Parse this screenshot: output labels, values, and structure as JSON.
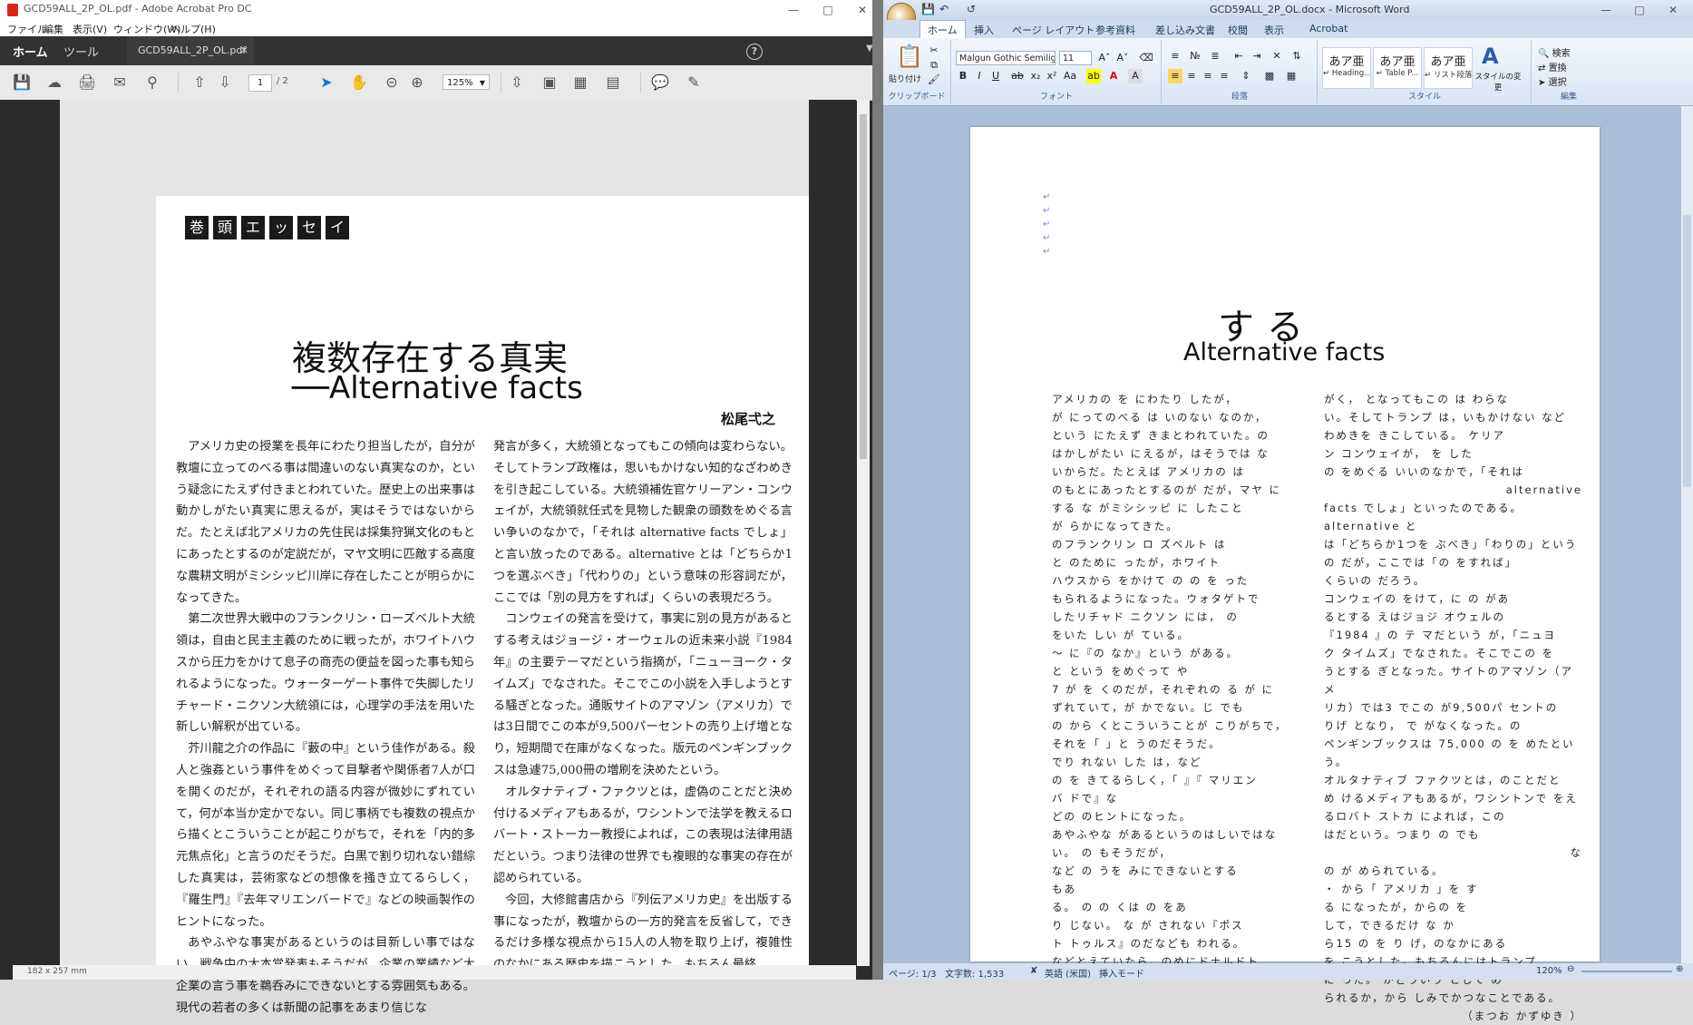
{
  "acrobat": {
    "window_title": "GCD59ALL_2P_OL.pdf - Adobe Acrobat Pro DC",
    "menu": [
      "ファイル",
      "編集",
      "表示(V)",
      "ウィンドウ(W)",
      "ヘルプ(H)"
    ],
    "tab_home": "ホーム",
    "tab_tools": "ツール",
    "doc_tab": "GCD59ALL_2P_OL.pdf",
    "page_current": "1",
    "page_total": "/ 2",
    "zoom": "125%",
    "page_size": "182 x 257 mm",
    "article": {
      "tag_chars": [
        "巻",
        "頭",
        "エ",
        "ッ",
        "セ",
        "イ"
      ],
      "title": "複数存在する真実",
      "subtitle": "──Alternative facts",
      "author": "松尾弌之",
      "col1": [
        "アメリカ史の授業を長年にわたり担当したが，自分が教壇に立ってのべる事は間違いのない真実なのか，という疑念にたえず付きまとわれていた。歴史上の出来事は動かしがたい真実に思えるが，実はそうではないからだ。たとえば北アメリカの先住民は採集狩猟文化のもとにあったとするのが定説だが，マヤ文明に匹敵する高度な農耕文明がミシシッピ川岸に存在したことが明らかになってきた。",
        "第二次世界大戦中のフランクリン・ローズベルト大統領は，自由と民主主義のために戦ったが，ホワイトハウスから圧力をかけて息子の商売の便益を図った事も知られるようになった。ウォーターゲート事件で失脚したリチャード・ニクソン大統領には，心理学の手法を用いた新しい解釈が出ている。",
        "芥川龍之介の作品に『藪の中』という佳作がある。殺人と強姦という事件をめぐって目撃者や関係者7人が口を開くのだが，それぞれの語る内容が微妙にずれていて，何が本当か定かでない。同じ事柄でも複数の視点から描くとこういうことが起こりがちで，それを「内的多元焦点化」と言うのだそうだ。白黒で割り切れない錯綜した真実は，芸術家などの想像を掻き立てるらしく，『羅生門』『去年マリエンバードで』などの映画製作のヒントになった。",
        "あやふやな事実があるというのは目新しい事ではない。戦争中の大本営発表もそうだが，企業の業績など大企業の言う事を鵜呑みにできないとする雰囲気もある。現代の若者の多くは新聞の記事をあまり信じな"
      ],
      "col2": [
        "発言が多く，大統領となってもこの傾向は変わらない。そしてトランプ政権は，思いもかけない知的なざわめきを引き起こしている。大統領補佐官ケリーアン・コンウェイが，大統領就任式を見物した観衆の頭数をめぐる言い争いのなかで，「それは alternative facts でしょ」と言い放ったのである。alternative とは「どちらか1つを選ぶべき」「代わりの」という意味の形容詞だが，ここでは「別の見方をすれば」くらいの表現だろう。",
        "コンウェイの発言を受けて，事実に別の見方があるとする考えはジョージ・オーウェルの近未来小説『1984年』の主要テーマだという指摘が，「ニューヨーク・タイムズ」でなされた。そこでこの小説を入手しようとする騒ぎとなった。通販サイトのアマゾン（アメリカ）では3日間でこの本が9,500パーセントの売り上げ増となり，短期間で在庫がなくなった。版元のペンギンブックスは急遽75,000冊の増刷を決めたという。",
        "オルタナティブ・ファクツとは，虚偽のことだと決め付けるメディアもあるが，ワシントンで法学を教えるロバート・ストーカー教授によれば，この表現は法律用語だという。つまり法律の世界でも複眼的な事実の存在が認められている。",
        "今回，大修館書店から『列伝アメリカ史』を出版する事になったが，教壇からの一方的発言を反省して，できるだけ多様な視点から15人の人物を取り上げ，複雑性のなかにある歴史を描こうとした。もちろん最終"
      ]
    }
  },
  "word": {
    "window_title": "GCD59ALL_2P_OL.docx - Microsoft Word",
    "tabs": [
      "ホーム",
      "挿入",
      "ページ レイアウト",
      "参考資料",
      "差し込み文書",
      "校閲",
      "表示",
      "Acrobat"
    ],
    "font_name": "Malgun Gothic Semilig",
    "font_size": "11",
    "paste_label": "貼り付け",
    "group_labels": [
      "クリップボード",
      "フォント",
      "段落",
      "スタイル",
      "編集"
    ],
    "styles": [
      {
        "glyph": "あア亜",
        "name": "↵ Heading..."
      },
      {
        "glyph": "あア亜",
        "name": "↵ Table P..."
      },
      {
        "glyph": "あア亜",
        "name": "↵ リスト段落"
      }
    ],
    "style_change": "スタイルの変更",
    "edit_items": [
      "検索",
      "置換",
      "選択"
    ],
    "doc_title": "する",
    "doc_subtitle": "Alternative facts",
    "status_page": "ページ: 1/3",
    "status_words": "文字数: 1,533",
    "status_lang": "英語 (米国)",
    "status_mode": "挿入モード",
    "zoom": "120%",
    "col1": [
      "アメリカの を にわたり したが，",
      "が にってのべる は いのない なのか，",
      "という にたえず きまとわれていた。の",
      "はかしがたい にえるが，はそうでは な",
      "いからだ。たとえば アメリカの は",
      "のもとにあったとするのが だが，マヤ に",
      "する な がミシシッピ に したこと",
      "が らかになってきた。",
      "のフランクリン ロ ズベルト は",
      "と のために ったが，ホワイト",
      "ハウスから をかけて の の を った",
      "もられるようになった。ウォタゲトで",
      "したリチャド ニクソン には， の",
      "をいた しい が ている。",
      "〜 に『の なか』という がある。",
      "と という をめぐって や",
      "7 が を くのだが，それぞれの る が に",
      "ずれていて，が かでない。じ でも",
      "の から くとこういうことが こりがちで，",
      "それを「 」と うのだそうだ。",
      "でり れない した は，など",
      "の を きてるらしく，「 』『 マリエン",
      "バ ドで』な",
      "どの のヒントになった。",
      "あやふやな があるというのはしいではな",
      "い。 の もそうだが，",
      "など の うを みにできないとする",
      "もあ",
      "る。 の の くは の をあ",
      "り じない。 な が されない『ポス",
      "ト トゥルス』のだなども われる。",
      "などとえていたら，のめにドナルドト"
    ],
    "col2": [
      "がく， となってもこの は わらな",
      "い。そしてトランプ は，いもかけない など",
      "わめきを きこしている。 ケリア",
      "ン コンウェイが， を した",
      "の をめぐる いいのなかで，「それは",
      "alternative",
      "facts でしょ」といったのである。alternative と",
      "は「どちらか1つを ぶべき」「わりの」という",
      "の だが，ここでは「の をすれば」",
      "くらいの だろう。",
      "コンウェイの をけて，に の があ",
      "るとする えはジョジ オウェルの",
      "『1984 』の テ マだという が，「ニュヨ",
      "ク タイムズ」でなされた。そこでこの を",
      "うとする ぎとなった。サイトのアマゾン（アメ",
      "リカ）では3 でこの が9,500パ セントの",
      "りげ となり， で がなくなった。の",
      "ペンギンブックスは 75,000 の を めたという。",
      "オルタナティブ ファクツとは，のことだと",
      "め けるメディアもあるが，ワシントンで をえ",
      "るロバト ストカ によれば，この",
      "はだという。つまり の でも",
      "な",
      "の が められている。",
      "・ から「 アメリカ 」を す",
      "る になったが，からの を",
      "して，できるだけ な か",
      "ら15 の を り げ，のなかにある",
      "を こうとした。もちろんにはトランプ",
      "に った。 がどういう として め",
      "られるか，から しみでかつなことである。",
      "（まつお かずゆき ）"
    ]
  }
}
